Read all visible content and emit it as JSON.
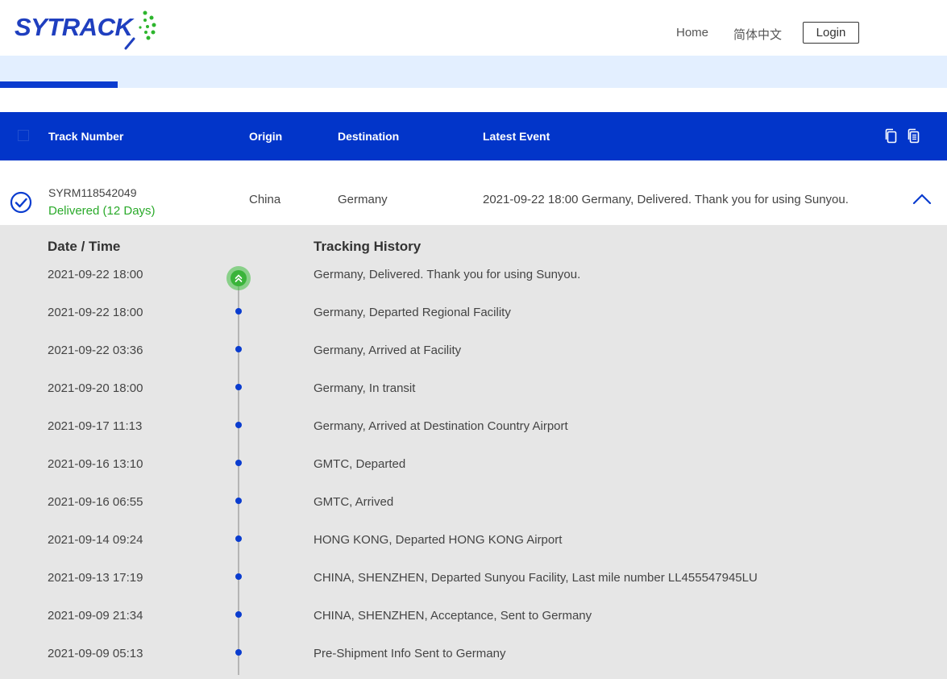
{
  "header": {
    "logo_text": "SYTRACK",
    "nav": {
      "home": "Home",
      "language": "简体中文",
      "login": "Login"
    }
  },
  "table": {
    "columns": {
      "track_number": "Track Number",
      "origin": "Origin",
      "destination": "Destination",
      "latest_event": "Latest Event"
    },
    "row": {
      "track_number": "SYRM118542049",
      "status": "Delivered (12 Days)",
      "origin": "China",
      "destination": "Germany",
      "latest_event": "2021-09-22 18:00 Germany, Delivered. Thank you for using Sunyou."
    }
  },
  "history": {
    "date_header": "Date / Time",
    "history_header": "Tracking History",
    "events": [
      {
        "time": "2021-09-22 18:00",
        "desc": "Germany, Delivered. Thank you for using Sunyou."
      },
      {
        "time": "2021-09-22 18:00",
        "desc": "Germany, Departed Regional Facility"
      },
      {
        "time": "2021-09-22 03:36",
        "desc": "Germany, Arrived at Facility"
      },
      {
        "time": "2021-09-20 18:00",
        "desc": "Germany, In transit"
      },
      {
        "time": "2021-09-17 11:13",
        "desc": "Germany, Arrived at Destination Country Airport"
      },
      {
        "time": "2021-09-16 13:10",
        "desc": "GMTC, Departed"
      },
      {
        "time": "2021-09-16 06:55",
        "desc": "GMTC, Arrived"
      },
      {
        "time": "2021-09-14 09:24",
        "desc": "HONG KONG, Departed HONG KONG Airport"
      },
      {
        "time": "2021-09-13 17:19",
        "desc": "CHINA, SHENZHEN, Departed Sunyou Facility, Last mile number LL455547945LU"
      },
      {
        "time": "2021-09-09 21:34",
        "desc": "CHINA, SHENZHEN, Acceptance, Sent to Germany"
      },
      {
        "time": "2021-09-09 05:13",
        "desc": "Pre-Shipment Info Sent to Germany"
      }
    ]
  },
  "colors": {
    "primary": "#0235c9",
    "delivered": "#2aaa2a",
    "band": "#e3efff",
    "detail_bg": "#e6e6e6"
  },
  "icons": {
    "copy": "copy-icon",
    "copy_all": "copy-all-icon",
    "check": "check-circle-icon",
    "collapse": "chevron-up-icon",
    "latest": "double-chevron-up-icon"
  }
}
